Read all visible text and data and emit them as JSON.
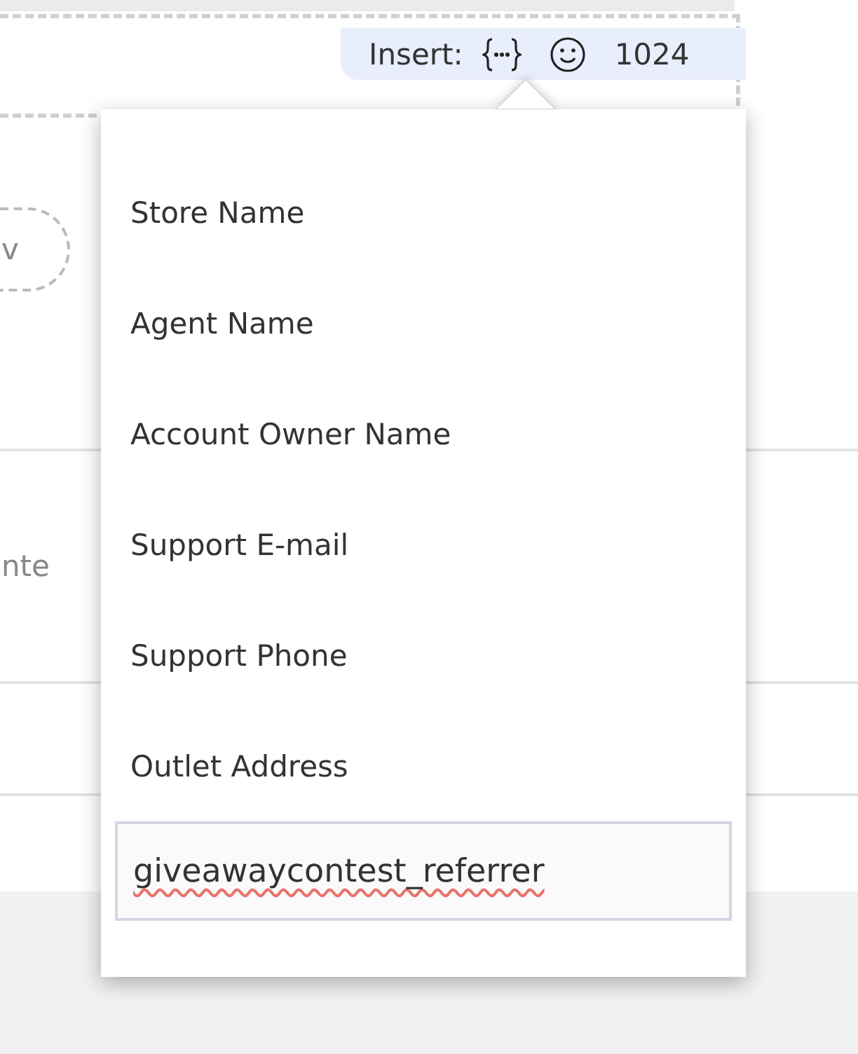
{
  "background": {
    "pill_text": "v",
    "row_text": "nte"
  },
  "insert_bar": {
    "label": "Insert:",
    "count": "1024"
  },
  "variable_menu": {
    "items": [
      {
        "label": "Store Name"
      },
      {
        "label": "Agent Name"
      },
      {
        "label": "Account Owner Name"
      },
      {
        "label": "Support E-mail"
      },
      {
        "label": "Support Phone"
      },
      {
        "label": "Outlet Address"
      }
    ],
    "custom_field": {
      "value": "giveawaycontest_referrer",
      "misspelled": true
    }
  }
}
